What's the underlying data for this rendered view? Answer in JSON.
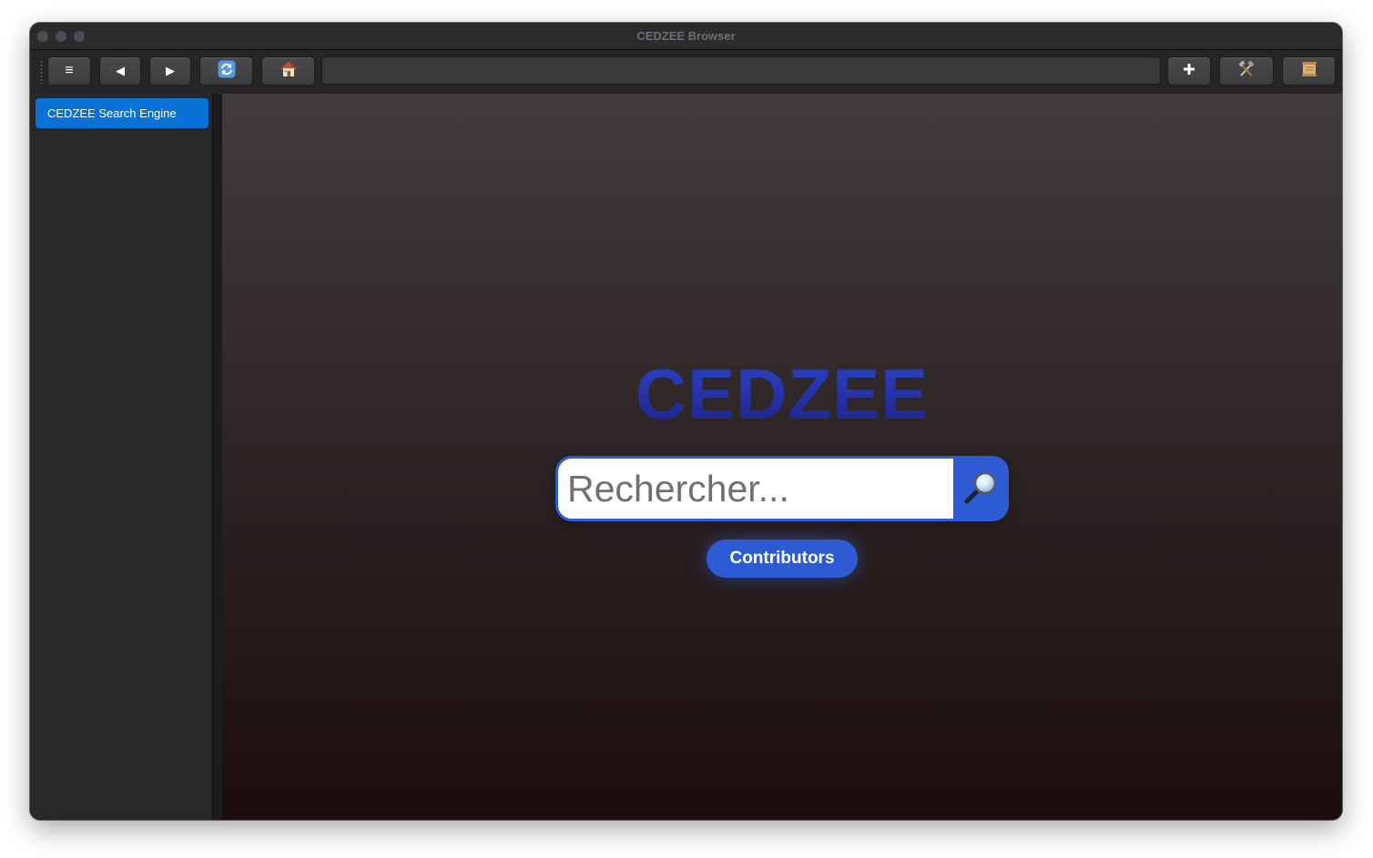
{
  "window": {
    "title": "CEDZEE Browser"
  },
  "toolbar": {
    "menu_label": "≡",
    "back_label": "◀",
    "forward_label": "▶",
    "url_value": ""
  },
  "sidebar": {
    "items": [
      {
        "label": "CEDZEE Search Engine",
        "selected": true
      }
    ]
  },
  "page": {
    "logo": "CEDZEE",
    "search": {
      "placeholder": "Rechercher...",
      "value": ""
    },
    "contributors_label": "Contributors"
  },
  "icons": {
    "menu": "hamburger-icon",
    "back": "back-arrow-icon",
    "forward": "forward-arrow-icon",
    "reload": "reload-icon",
    "home": "home-icon",
    "new_tab": "plus-icon",
    "tools": "tools-icon",
    "history": "scroll-icon",
    "search": "magnifier-icon"
  },
  "colors": {
    "accent": "#2d5bd4",
    "sidebar_selected": "#0a72d6",
    "logo": "#2a3ab6"
  }
}
